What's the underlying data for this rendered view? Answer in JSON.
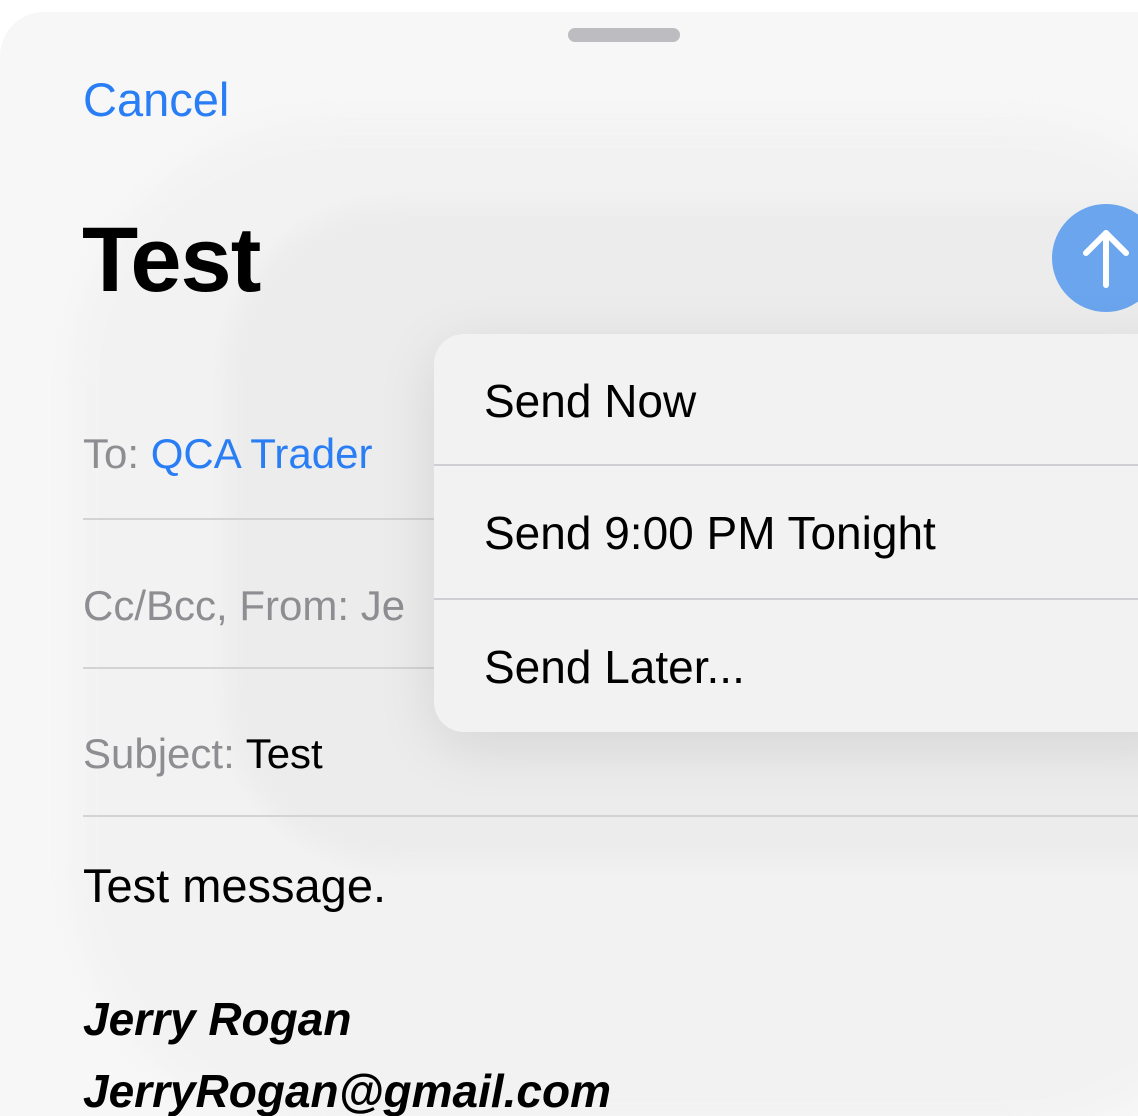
{
  "header": {
    "cancel_label": "Cancel",
    "title": "Test"
  },
  "send_button": {
    "icon": "arrow-up-icon",
    "color": "#6aa5ee"
  },
  "fields": {
    "to_label": "To:",
    "to_value": "QCA Trader",
    "cc_label": "Cc/Bcc, From:",
    "cc_value": "Je",
    "subject_label": "Subject:",
    "subject_value": "Test"
  },
  "body": {
    "message": "Test message.",
    "signature_name": "Jerry Rogan",
    "signature_email": "JerryRogan@gmail.com"
  },
  "send_menu": {
    "items": [
      {
        "label": "Send Now"
      },
      {
        "label": "Send 9:00 PM Tonight"
      },
      {
        "label": "Send Later..."
      }
    ]
  },
  "colors": {
    "accent": "#2a7ef5",
    "secondary_text": "#8e8e92"
  }
}
